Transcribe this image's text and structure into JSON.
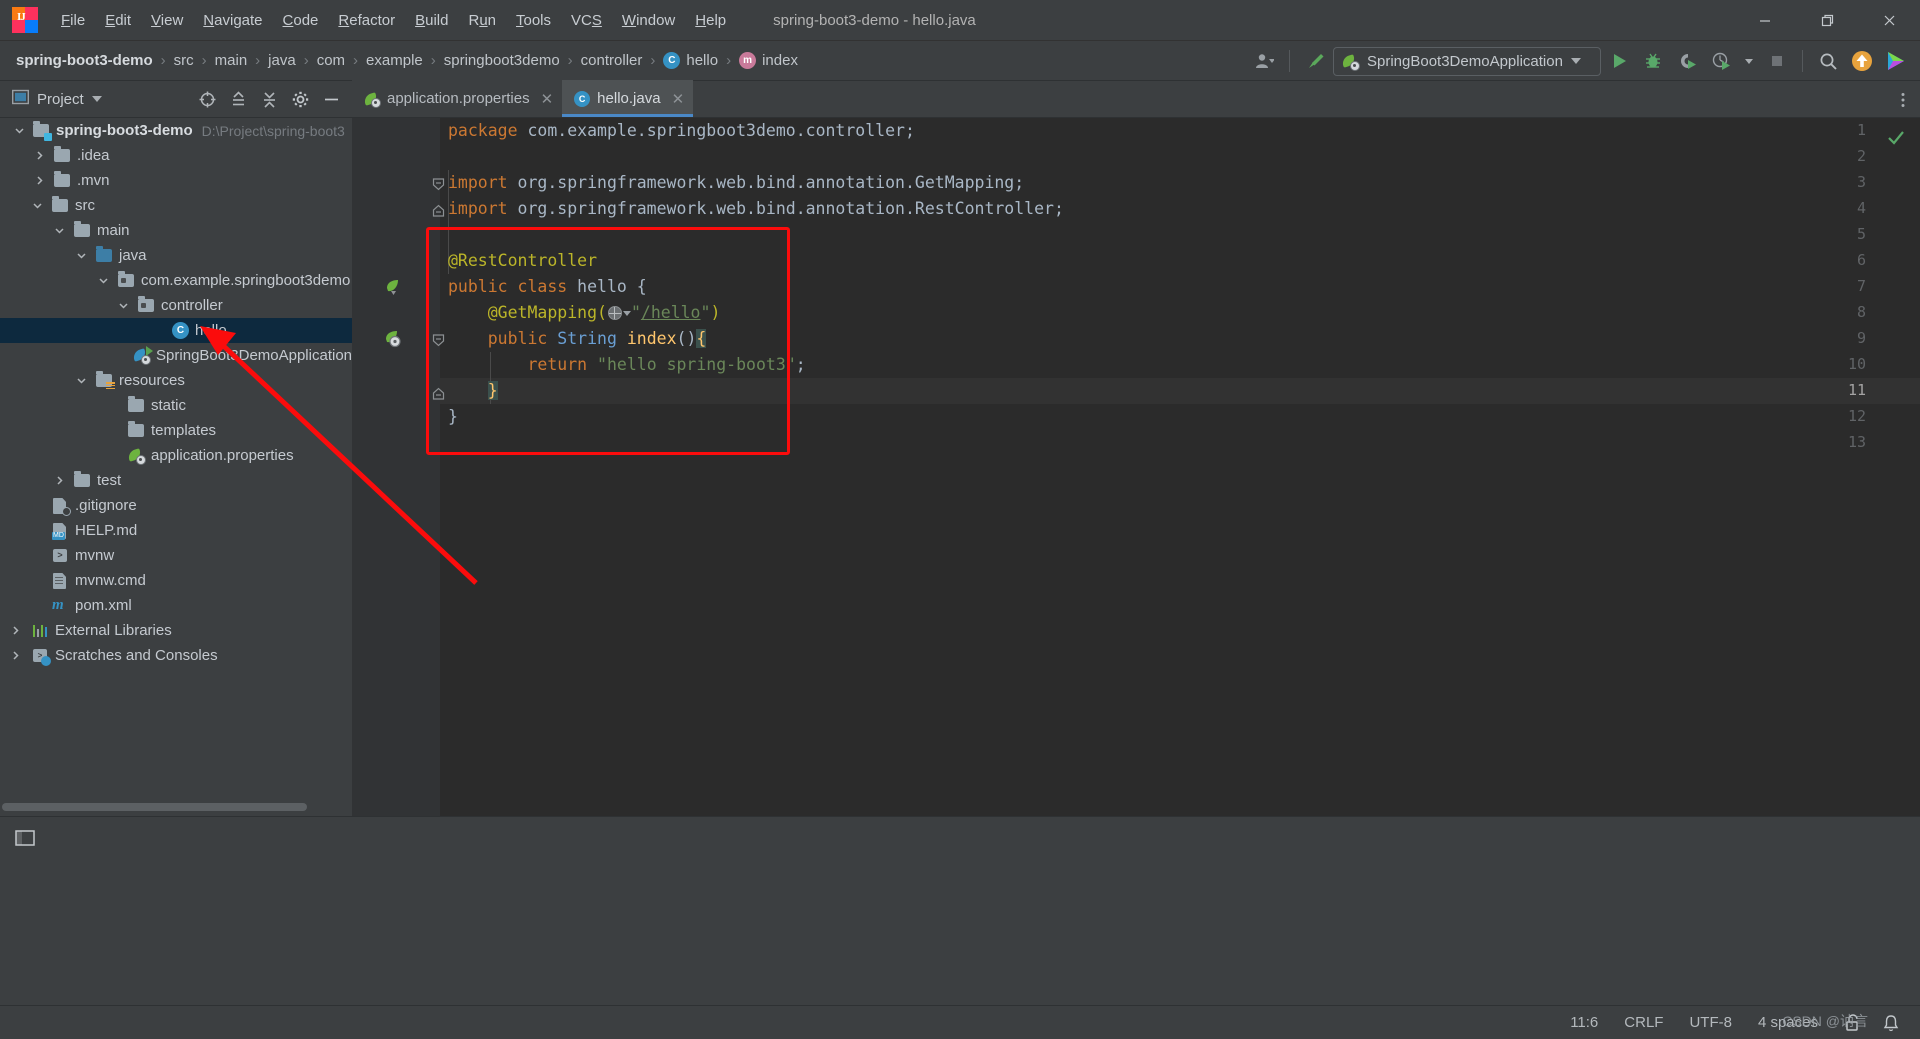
{
  "window": {
    "title": "spring-boot3-demo - hello.java",
    "app_icon": "intellij-idea-logo",
    "minimize": "minimize-icon",
    "maximize": "maximize-icon",
    "close": "close-icon"
  },
  "menubar": {
    "items": [
      {
        "label": "File",
        "mnemonic": "F"
      },
      {
        "label": "Edit",
        "mnemonic": "E"
      },
      {
        "label": "View",
        "mnemonic": "V"
      },
      {
        "label": "Navigate",
        "mnemonic": "N"
      },
      {
        "label": "Code",
        "mnemonic": "C"
      },
      {
        "label": "Refactor",
        "mnemonic": "R"
      },
      {
        "label": "Build",
        "mnemonic": "B"
      },
      {
        "label": "Run",
        "mnemonic": "u"
      },
      {
        "label": "Tools",
        "mnemonic": "T"
      },
      {
        "label": "VCS",
        "mnemonic": "S"
      },
      {
        "label": "Window",
        "mnemonic": "W"
      },
      {
        "label": "Help",
        "mnemonic": "H"
      }
    ]
  },
  "breadcrumb": {
    "separator": "›",
    "items": [
      {
        "label": "spring-boot3-demo",
        "bold": true,
        "icon": null
      },
      {
        "label": "src",
        "bold": false,
        "icon": null
      },
      {
        "label": "main",
        "bold": false,
        "icon": null
      },
      {
        "label": "java",
        "bold": false,
        "icon": null
      },
      {
        "label": "com",
        "bold": false,
        "icon": null
      },
      {
        "label": "example",
        "bold": false,
        "icon": null
      },
      {
        "label": "springboot3demo",
        "bold": false,
        "icon": null
      },
      {
        "label": "controller",
        "bold": false,
        "icon": null
      },
      {
        "label": "hello",
        "bold": false,
        "icon": "class-icon",
        "icon_letter": "C"
      },
      {
        "label": "index",
        "bold": false,
        "icon": "method-icon",
        "icon_letter": "m"
      }
    ]
  },
  "toolbar": {
    "user_icon": "user-avatar-icon",
    "user_caret": "chevron-down-icon",
    "build_icon": "build-hammer-icon",
    "run_config": {
      "icon": "spring-boot-icon",
      "label": "SpringBoot3DemoApplication",
      "caret": "chevron-down-icon"
    },
    "run_icon": "run-play-icon",
    "debug_icon": "debug-bug-icon",
    "run_coverage_icon": "run-with-coverage-icon",
    "profile_icon": "profiler-icon",
    "profile_caret": "chevron-down-icon",
    "stop_icon": "stop-square-icon",
    "search_icon": "search-magnifier-icon",
    "update_icon": "update-arrow-icon",
    "ide_icon": "ide-services-icon"
  },
  "project_panel": {
    "icon": "project-view-icon",
    "title": "Project",
    "title_caret": "chevron-down-icon",
    "tools": [
      {
        "name": "select-opened-file-icon"
      },
      {
        "name": "expand-all-icon"
      },
      {
        "name": "collapse-all-icon"
      },
      {
        "name": "settings-gear-icon"
      },
      {
        "name": "hide-panel-icon"
      }
    ],
    "tree": [
      {
        "label": "spring-boot3-demo",
        "path": "D:\\Project\\spring-boot3",
        "depth": 0,
        "arrow": "down",
        "icon": "project-root-folder-icon",
        "bold": true,
        "selected": false
      },
      {
        "label": ".idea",
        "depth": 1,
        "arrow": "right",
        "icon": "folder-icon",
        "selected": false
      },
      {
        "label": ".mvn",
        "depth": 1,
        "arrow": "right",
        "icon": "folder-icon",
        "selected": false
      },
      {
        "label": "src",
        "depth": 1,
        "arrow": "down",
        "icon": "folder-icon",
        "selected": false
      },
      {
        "label": "main",
        "depth": 2,
        "arrow": "down",
        "icon": "folder-icon",
        "selected": false
      },
      {
        "label": "java",
        "depth": 3,
        "arrow": "down",
        "icon": "source-folder-icon",
        "selected": false
      },
      {
        "label": "com.example.springboot3demo",
        "depth": 4,
        "arrow": "down",
        "icon": "package-icon",
        "selected": false
      },
      {
        "label": "controller",
        "depth": 5,
        "arrow": "down",
        "icon": "package-icon",
        "selected": false
      },
      {
        "label": "hello",
        "depth": 6,
        "arrow": "none",
        "icon": "java-class-icon",
        "selected": true
      },
      {
        "label": "SpringBoot3DemoApplication",
        "depth": 6,
        "arrow": "none",
        "icon": "spring-boot-app-icon",
        "selected": false
      },
      {
        "label": "resources",
        "depth": 3,
        "arrow": "down",
        "icon": "resources-folder-icon",
        "selected": false
      },
      {
        "label": "static",
        "depth": 4,
        "arrow": "none",
        "icon": "folder-icon",
        "selected": false
      },
      {
        "label": "templates",
        "depth": 4,
        "arrow": "none",
        "icon": "folder-icon",
        "selected": false
      },
      {
        "label": "application.properties",
        "depth": 4,
        "arrow": "none",
        "icon": "spring-properties-icon",
        "selected": false
      },
      {
        "label": "test",
        "depth": 2,
        "arrow": "right",
        "icon": "folder-icon",
        "selected": false
      },
      {
        "label": ".gitignore",
        "depth": 1,
        "arrow": "none",
        "icon": "gitignore-file-icon",
        "selected": false
      },
      {
        "label": "HELP.md",
        "depth": 1,
        "arrow": "none",
        "icon": "markdown-file-icon",
        "badge": "MD",
        "selected": false
      },
      {
        "label": "mvnw",
        "depth": 1,
        "arrow": "none",
        "icon": "shell-script-icon",
        "selected": false
      },
      {
        "label": "mvnw.cmd",
        "depth": 1,
        "arrow": "none",
        "icon": "text-file-icon",
        "selected": false
      },
      {
        "label": "pom.xml",
        "depth": 1,
        "arrow": "none",
        "icon": "maven-pom-icon",
        "selected": false
      },
      {
        "label": "External Libraries",
        "depth": 0,
        "arrow": "right",
        "icon": "external-libraries-icon",
        "selected": false
      },
      {
        "label": "Scratches and Consoles",
        "depth": 0,
        "arrow": "right",
        "icon": "scratches-icon",
        "selected": false
      }
    ]
  },
  "editor": {
    "tabs": [
      {
        "label": "application.properties",
        "icon": "spring-properties-icon",
        "active": false,
        "close": "close-icon"
      },
      {
        "label": "hello.java",
        "icon": "java-class-icon",
        "active": true,
        "close": "close-icon"
      }
    ],
    "more_icon": "more-options-icon",
    "inspection_ok_icon": "inspection-ok-checkmark",
    "gutter_run_icon_line7": "spring-bean-gutter-icon",
    "gutter_run_icon_line9": "spring-mapping-gutter-icon",
    "current_line": 11,
    "lines": [
      {
        "n": 1,
        "tokens": [
          {
            "t": "package ",
            "c": "kw"
          },
          {
            "t": "com.example.springboot3demo.controller",
            "c": "pk"
          },
          {
            "t": ";",
            "c": "pn"
          }
        ]
      },
      {
        "n": 2,
        "tokens": []
      },
      {
        "n": 3,
        "tokens": [
          {
            "t": "import ",
            "c": "kw"
          },
          {
            "t": "org.springframework.web.bind.annotation.",
            "c": "pk"
          },
          {
            "t": "GetMapping",
            "c": "pk"
          },
          {
            "t": ";",
            "c": "pn"
          }
        ],
        "fold": "collapse-minus"
      },
      {
        "n": 4,
        "tokens": [
          {
            "t": "import ",
            "c": "kw"
          },
          {
            "t": "org.springframework.web.bind.annotation.",
            "c": "pk"
          },
          {
            "t": "RestController",
            "c": "pk"
          },
          {
            "t": ";",
            "c": "pn"
          }
        ],
        "fold": "fold-end"
      },
      {
        "n": 5,
        "tokens": []
      },
      {
        "n": 6,
        "tokens": [
          {
            "t": "@RestController",
            "c": "ann"
          }
        ]
      },
      {
        "n": 7,
        "tokens": [
          {
            "t": "public ",
            "c": "kw"
          },
          {
            "t": "class ",
            "c": "kw"
          },
          {
            "t": "hello ",
            "c": "cls"
          },
          {
            "t": "{",
            "c": "pn"
          }
        ]
      },
      {
        "n": 8,
        "tokens": [
          {
            "t": "    @GetMapping(",
            "c": "ann"
          },
          {
            "t": "GLOBE",
            "c": "icon"
          },
          {
            "t": "\"",
            "c": "str"
          },
          {
            "t": "/hello",
            "c": "link"
          },
          {
            "t": "\"",
            "c": "str"
          },
          {
            "t": ")",
            "c": "ann"
          }
        ]
      },
      {
        "n": 9,
        "tokens": [
          {
            "t": "    ",
            "c": "pn"
          },
          {
            "t": "public ",
            "c": "kw"
          },
          {
            "t": "String ",
            "c": "type"
          },
          {
            "t": "index",
            "c": "meth"
          },
          {
            "t": "()",
            "c": "pn"
          },
          {
            "t": "{",
            "c": "brace-hl"
          }
        ],
        "fold": "collapse-minus"
      },
      {
        "n": 10,
        "tokens": [
          {
            "t": "        ",
            "c": "pn"
          },
          {
            "t": "return ",
            "c": "kw"
          },
          {
            "t": "\"hello spring-boot3\"",
            "c": "str"
          },
          {
            "t": ";",
            "c": "pn"
          }
        ]
      },
      {
        "n": 11,
        "tokens": [
          {
            "t": "    ",
            "c": "pn"
          },
          {
            "t": "}",
            "c": "brace-hl"
          }
        ],
        "fold": "fold-end",
        "current": true
      },
      {
        "n": 12,
        "tokens": [
          {
            "t": "}",
            "c": "pn"
          }
        ]
      },
      {
        "n": 13,
        "tokens": []
      }
    ]
  },
  "annotation": {
    "highlight_box": "red-rectangle-highlight",
    "arrow": "red-pointer-arrow"
  },
  "statusbar": {
    "items": [
      {
        "label": "11:6",
        "name": "caret-position"
      },
      {
        "label": "CRLF",
        "name": "line-separator"
      },
      {
        "label": "UTF-8",
        "name": "file-encoding"
      },
      {
        "label": "4 spaces",
        "name": "indent-setting"
      }
    ],
    "lock_icon": "read-only-lock-icon",
    "notification_icon": "notifications-bell-icon",
    "watermark": "CSDN @讷言"
  },
  "colors": {
    "ide_bg": "#3c3f41",
    "editor_bg": "#2b2b2b",
    "gutter_bg": "#313335",
    "selection": "#0d293e",
    "accent_blue": "#4a88c7",
    "annotation_red": "#fb0c0c",
    "spring_green": "#6db33f",
    "keyword_orange": "#cc7832",
    "string_green": "#6a8759",
    "annotation_yellow": "#bbb529",
    "method_yellow": "#ffc66d",
    "type_blue": "#6a9fd4"
  }
}
